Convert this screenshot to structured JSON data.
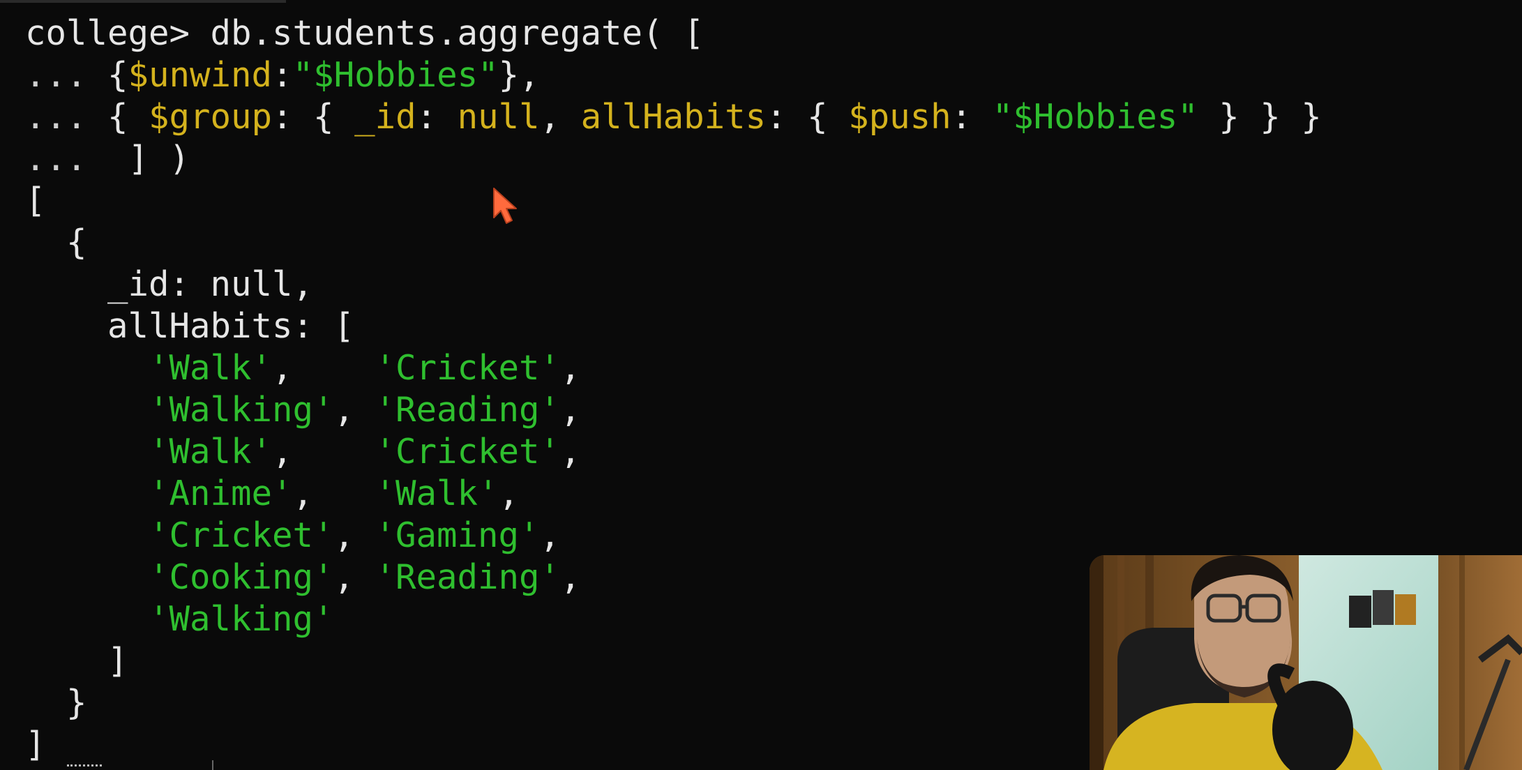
{
  "terminal": {
    "prompt": "college> ",
    "command": "db.students.aggregate( [",
    "cont": "...",
    "unwind_key": "$unwind",
    "unwind_value": "\"$Hobbies\"",
    "group_key": "$group",
    "id_key": "_id",
    "null_value": "null",
    "allhabits_key": "allHabits",
    "push_key": "$push",
    "push_value": "\"$Hobbies\"",
    "close_cmd": "] )",
    "result": {
      "open_bracket": "[",
      "open_brace": "{",
      "id_line": "_id: null,",
      "allhabits_line": "allHabits: [",
      "habits": [
        "'Walk'",
        "'Cricket'",
        "'Walking'",
        "'Reading'",
        "'Walk'",
        "'Cricket'",
        "'Anime'",
        "'Walk'",
        "'Cricket'",
        "'Gaming'",
        "'Cooking'",
        "'Reading'",
        "'Walking'"
      ],
      "close_array": "]",
      "close_brace": "}",
      "close_bracket": "]"
    }
  },
  "icons": {
    "cursor": "mouse-pointer-icon"
  },
  "colors": {
    "background": "#0a0a0a",
    "text": "#e6e6e6",
    "key_yellow": "#d4b21d",
    "string_green": "#2fbf2f",
    "cursor_orange": "#ff6a3d"
  }
}
